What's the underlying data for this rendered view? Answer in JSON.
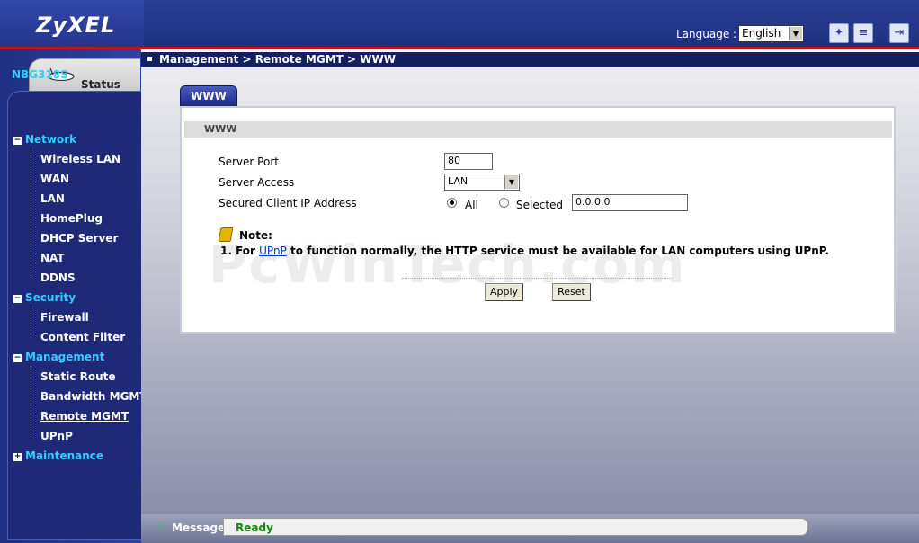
{
  "header": {
    "brand": "ZyXEL",
    "language_label": "Language :",
    "language_value": "English",
    "icons": [
      "wizard-icon",
      "notes-icon",
      "logout-icon"
    ]
  },
  "sidebar": {
    "status_label": "Status",
    "device": "NBG318S",
    "groups": [
      {
        "label": "Network",
        "expanded": true,
        "items": [
          "Wireless LAN",
          "WAN",
          "LAN",
          "HomePlug",
          "DHCP Server",
          "NAT",
          "DDNS"
        ]
      },
      {
        "label": "Security",
        "expanded": true,
        "items": [
          "Firewall",
          "Content Filter"
        ]
      },
      {
        "label": "Management",
        "expanded": true,
        "items": [
          "Static Route",
          "Bandwidth MGMT",
          "Remote MGMT",
          "UPnP"
        ]
      },
      {
        "label": "Maintenance",
        "expanded": false,
        "items": []
      }
    ],
    "active_item": "Remote MGMT"
  },
  "breadcrumb": "Management > Remote MGMT > WWW",
  "tab": "WWW",
  "section_title": "WWW",
  "form": {
    "server_port_label": "Server Port",
    "server_port_value": "80",
    "server_access_label": "Server Access",
    "server_access_value": "LAN",
    "secured_ip_label": "Secured Client IP Address",
    "radio_all": "All",
    "radio_selected": "Selected",
    "selected_option": "All",
    "ip_value": "0.0.0.0"
  },
  "note": {
    "title": "Note:",
    "prefix": "1. For ",
    "link": "UPnP",
    "suffix": " to function normally, the HTTP service must be available for LAN computers using UPnP."
  },
  "watermark": "PcWinTech.com",
  "buttons": {
    "apply": "Apply",
    "reset": "Reset"
  },
  "footer": {
    "message_label": "Message",
    "message": "Ready"
  },
  "colors": {
    "nav_group": "#33ccff",
    "header_bg": "#2a3f94",
    "header_rule": "#c0141a",
    "status_ok": "#118811"
  }
}
